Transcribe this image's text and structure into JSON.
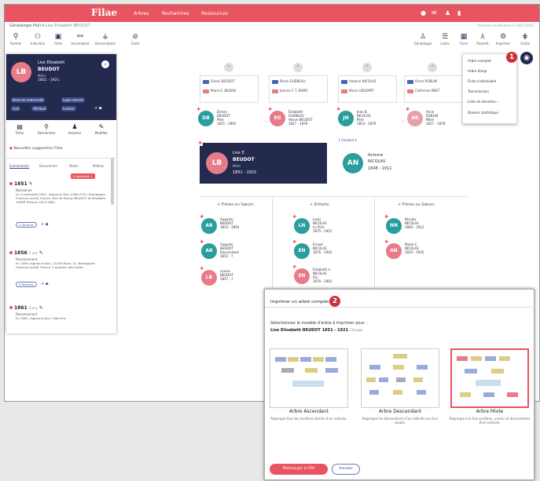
{
  "topbar": {
    "logo": "Filae",
    "nav": [
      "Arbres",
      "Recherches",
      "Ressources"
    ],
    "icons": [
      "user-icon",
      "mail-icon",
      "person-icon",
      "flag-icon"
    ]
  },
  "breadcrumb": {
    "tree": "Généalogie Poili",
    "person": "Lise Elisabeth BEUDOT",
    "right": "Dernière modification le 24/11/2021"
  },
  "toolbar_left": [
    {
      "icon": "family-icon",
      "label": "Famille"
    },
    {
      "icon": "people-icon",
      "label": "Individus"
    },
    {
      "icon": "layout-icon",
      "label": "Fiche"
    },
    {
      "icon": "share-icon",
      "label": "Ascendants"
    },
    {
      "icon": "tree-icon",
      "label": "Descendants"
    },
    {
      "icon": "compass-icon",
      "label": "Carte"
    }
  ],
  "toolbar_right": [
    {
      "icon": "tree-icon",
      "label": "Généalogie"
    },
    {
      "icon": "list-icon",
      "label": "Listes"
    },
    {
      "icon": "calendar-icon",
      "label": "Fiche"
    },
    {
      "icon": "tree-icon",
      "label": "Parenté"
    },
    {
      "icon": "gear-icon",
      "label": "Imprimer"
    },
    {
      "icon": "grid-icon",
      "label": "Outils"
    }
  ],
  "sidebar": {
    "initials": "LB",
    "first_name": "Lise Elisabeth",
    "last_name": "BEUDOT",
    "role": "Mère",
    "dates": "1851 - 1921",
    "chips": [
      "Branche maternelle",
      "Ligne directe",
      "Lien",
      "Attribué",
      "Lecteur"
    ],
    "actions": [
      "Fiche",
      "Rechercher",
      "Associer",
      "Modifier"
    ],
    "suggestion": "Nouvelles suggestions Filae",
    "tabs": [
      "Evénements",
      "Documents",
      "Notes",
      "Médias"
    ],
    "suggestion_badge": "Suggestion 1",
    "events": [
      {
        "year": "1851",
        "type": "Naissance",
        "text": "Le 2 novembre 1851, Aignay-le-Duc (Côte-d'Or), Bourgogne-Franche-Comté, France. Fille de Dimon BEUDOT et Elisabeth VIVIER Prénom 1814-1881",
        "tag": "2 Sources"
      },
      {
        "year": "1856",
        "extra": "5 ans",
        "type": "Recensement",
        "text": "En 1856, Aignay-le-Duc, 21000 Dijon, 21, Bourgogne-Franche-Comté, France. 2 quartier des Halles",
        "tag": "4 Sources"
      },
      {
        "year": "1861",
        "extra": "9 ans",
        "type": "Recensement",
        "text": "En 1861, Aignay-le-Duc Côte-d'Or"
      }
    ]
  },
  "ancestors": [
    {
      "father": "Simon BEUDOT",
      "mother": "Marie E. BEDON"
    },
    {
      "father": "Pierre GUENEAU",
      "mother": "Jeanne F. T. REMO"
    },
    {
      "father": "Antoine NICOLAS",
      "mother": "Marie LEDOMPT"
    },
    {
      "father": "Pierre ROBLIN",
      "mother": "Catherine BRET"
    }
  ],
  "parents": [
    {
      "initials": "DB",
      "name": "Dimon\nBEUDOT\nPère\n1821 - 1892",
      "color": "#2a9d9d"
    },
    {
      "initials": "EG",
      "name": "Elisabeth\nGUENEAU\nVeuve BEUDOT\n1827 - 1878",
      "color": "#e87b88"
    },
    {
      "initials": "JN",
      "name": "Jean B.\nNICOLAS\nPère\n1813 - 1879",
      "color": "#2a9d9d"
    },
    {
      "initials": "AR",
      "name": "Anne\nROBLIN\nMère\n1817 - 1878",
      "color": "#e8a0a8"
    }
  ],
  "focus": {
    "initials": "LB",
    "first": "Lise E.",
    "last": "BEUDOT",
    "role": "Mère",
    "dates": "1851 - 1921"
  },
  "union_label": "1 Conjoint",
  "spouse": {
    "initials": "AN",
    "first": "Antoine",
    "last": "NICOLAS",
    "dates": "1848 - 1911"
  },
  "section_headers": [
    "+ Frères ou Sœurs",
    "+ Enfants",
    "+ Frères ou Sœurs"
  ],
  "siblings": [
    {
      "initials": "AB",
      "name": "Auguste\nBEUDOT\n1853 - 1894",
      "color": "#2a9d9d"
    },
    {
      "initials": "AB",
      "name": "Auguste\nBEUDOT\nDescendant\n1855 - ?",
      "color": "#2a9d9d"
    },
    {
      "initials": "LB",
      "name": "Louise\nBEUDOT\n1857 - ?",
      "color": "#e87b88"
    }
  ],
  "children": [
    {
      "initials": "LN",
      "name": "Louis\nNICOLAS\nLe Père\n1875 - 1952",
      "color": "#2a9d9d"
    },
    {
      "initials": "EN",
      "name": "Ernest\nNICOLAS\n1876 - 1942",
      "color": "#2a9d9d"
    },
    {
      "initials": "EN",
      "name": "Elisabeth L.\nNICOLAS\nFils\n1879 - 1962",
      "color": "#e87b88"
    }
  ],
  "spouse_siblings": [
    {
      "initials": "NN",
      "name": "Nicolas\nNICOLAS\n1846 - 1912",
      "color": "#2a9d9d"
    },
    {
      "initials": "AN",
      "name": "Marie C.\nNICOLAS\n1850 - 1935",
      "color": "#e87b88"
    }
  ],
  "menu": {
    "items": [
      "Arbre complet",
      "Arbre élargi",
      "Fiche individuelle",
      "Transmission",
      "Liste de données",
      "Dossier statistique"
    ],
    "callout": "1"
  },
  "dialog": {
    "title": "Imprimer un arbre complet",
    "callout": "2",
    "prompt": "Sélectionnez le modèle d'arbre à imprimer pour :",
    "subject": "Lise Elisabeth BEUDOT 1851 - 1921",
    "change": "Changer",
    "options": [
      {
        "title": "Arbre Ascendant",
        "desc": "Regroupe tous les ancêtres directs d'un individu."
      },
      {
        "title": "Arbre Descendant",
        "desc": "Regroupe les descendants d'un individu ou d'un couple."
      },
      {
        "title": "Arbre Mixte",
        "desc": "Regroupe à la fois ancêtres, unions et descendants d'un individu."
      }
    ],
    "primary": "Télécharger le PDF",
    "secondary": "Annuler"
  }
}
